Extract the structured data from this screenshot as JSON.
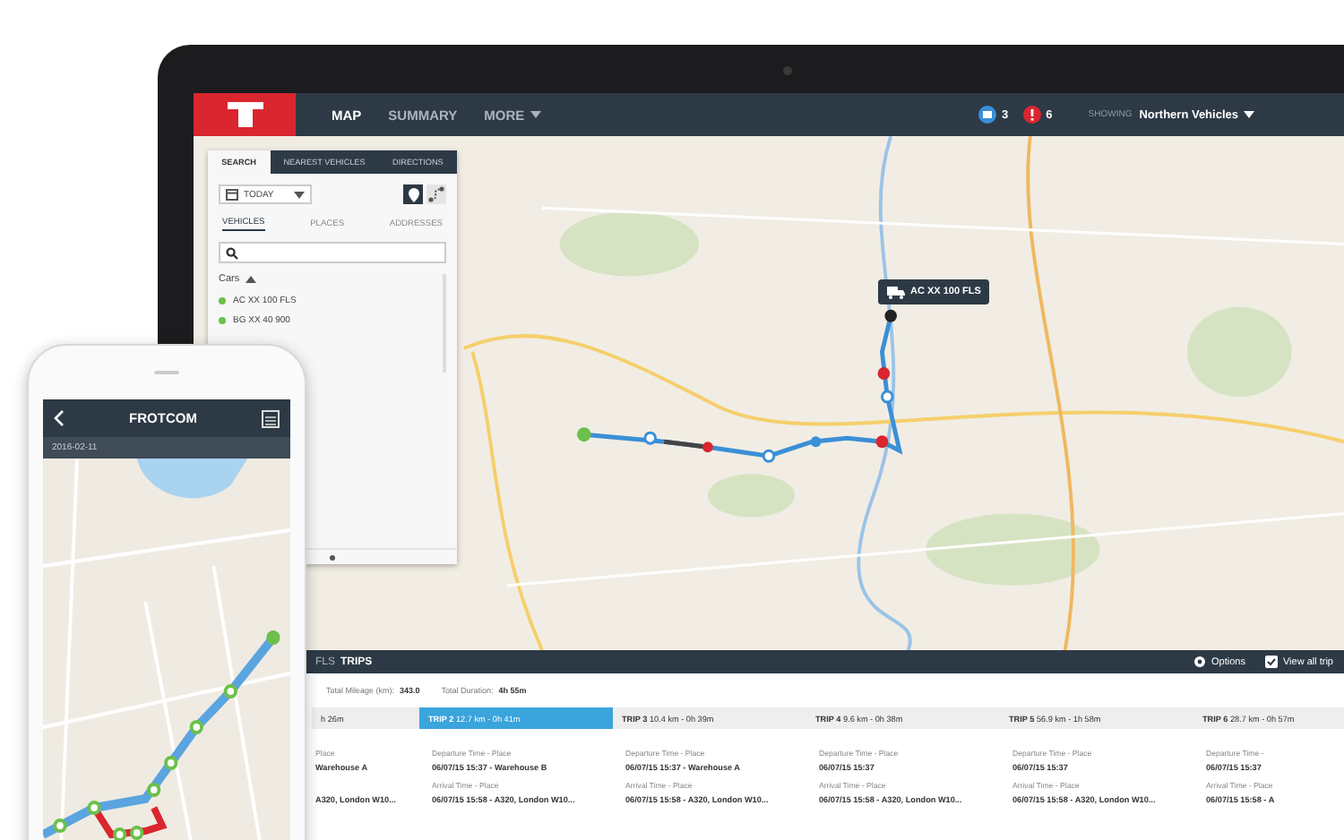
{
  "nav": {
    "items": [
      {
        "label": "MAP",
        "kind": "link",
        "selected": true
      },
      {
        "label": "SUMMARY",
        "kind": "link",
        "selected": false
      },
      {
        "label": "MORE",
        "kind": "menu",
        "selected": false
      }
    ],
    "notifications": [
      {
        "kind": "messages",
        "count": "3"
      },
      {
        "kind": "alerts",
        "count": "6"
      }
    ],
    "showing": {
      "label": "SHOWING",
      "value": "Northern Vehicles"
    }
  },
  "sidebar": {
    "tabs": [
      {
        "label": "SEARCH",
        "selected": true
      },
      {
        "label": "NEAREST VEHICLES",
        "selected": false
      },
      {
        "label": "DIRECTIONS",
        "selected": false
      }
    ],
    "date": "TODAY",
    "view_buttons": [
      {
        "kind": "pin",
        "selected": true
      },
      {
        "kind": "route",
        "selected": false
      }
    ],
    "subtabs": [
      {
        "label": "VEHICLES",
        "selected": true
      },
      {
        "label": "PLACES",
        "selected": false
      },
      {
        "label": "ADDRESSES",
        "selected": false
      }
    ],
    "group": {
      "label": "Cars",
      "expanded": true
    },
    "vehicles": [
      {
        "name": "AC XX 100 FLS",
        "color": "#6cc04a"
      },
      {
        "name": "BG XX 40 900",
        "color": "#6cc04a"
      }
    ]
  },
  "map": {
    "marker": {
      "label": "AC XX 100 FLS"
    }
  },
  "trips_panel": {
    "vehicle": "FLS",
    "title": "TRIPS",
    "actions": [
      {
        "kind": "options",
        "label": "Options"
      },
      {
        "kind": "view-all",
        "label": "View all trip"
      }
    ],
    "totals": [
      {
        "label": "Total Mileage (km):",
        "value": "343.0"
      },
      {
        "label": "Total Duration:",
        "value": "4h 55m"
      }
    ],
    "trips": [
      {
        "summary": "h 26m",
        "selected": false,
        "departure_label": "Place",
        "departure": "Warehouse A",
        "arrival": "A320, London W10..."
      },
      {
        "name": "TRIP 2",
        "summary": "12.7 km - 0h 41m",
        "selected": true,
        "departure_label": "Departure Time - Place",
        "departure": "06/07/15 15:37 - Warehouse B",
        "arrival_label": "Arrival Time - Place",
        "arrival": "06/07/15 15:58 - A320, London W10..."
      },
      {
        "name": "TRIP 3",
        "summary": "10.4 km - 0h 39m",
        "selected": false,
        "departure_label": "Departure Time - Place",
        "departure": "06/07/15 15:37 - Warehouse A",
        "arrival_label": "Arrival Time - Place",
        "arrival": "06/07/15 15:58 - A320, London W10..."
      },
      {
        "name": "TRIP 4",
        "summary": "9.6 km - 0h 38m",
        "selected": false,
        "departure_label": "Departure Time - Place",
        "departure": "06/07/15 15:37",
        "arrival_label": "Arrival Time - Place",
        "arrival": "06/07/15 15:58 - A320, London W10..."
      },
      {
        "name": "TRIP 5",
        "summary": "56.9 km - 1h 58m",
        "selected": false,
        "departure_label": "Departure Time - Place",
        "departure": "06/07/15 15:37",
        "arrival_label": "Arrival Time - Place",
        "arrival": "06/07/15 15:58 - A320, London W10..."
      },
      {
        "name": "TRIP 6",
        "summary": "28.7 km - 0h 57m",
        "selected": false,
        "departure_label": "Departure Time -",
        "departure": "06/07/15 15:37",
        "arrival_label": "Arrival Time - Place",
        "arrival": "06/07/15 15:58 - A"
      }
    ]
  },
  "phone": {
    "title": "FROTCOM",
    "date": "2016-02-11"
  }
}
